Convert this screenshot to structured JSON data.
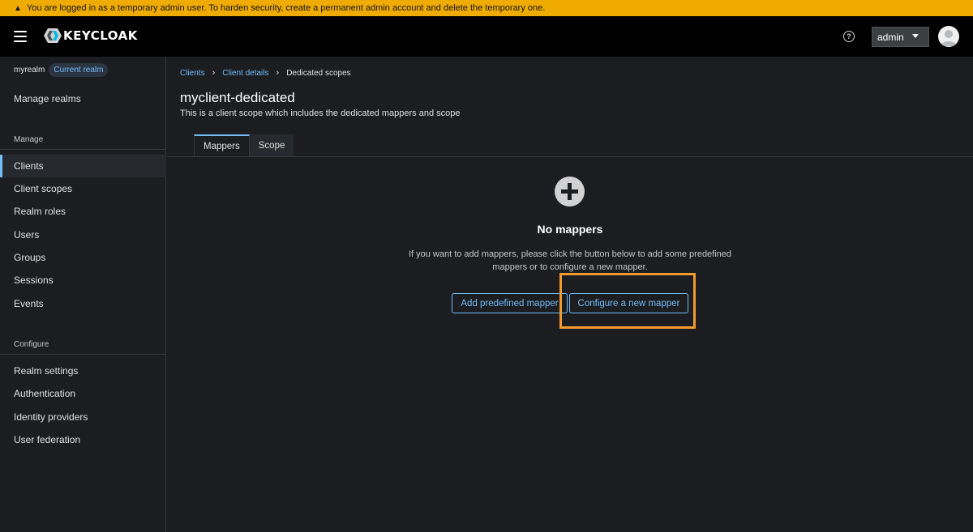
{
  "banner": {
    "text": "You are logged in as a temporary admin user. To harden security, create a permanent admin account and delete the temporary one."
  },
  "header": {
    "logo_text": "KEYCLOAK",
    "user_label": "admin"
  },
  "sidebar": {
    "realm_name": "myrealm",
    "realm_badge": "Current realm",
    "manage_realms": "Manage realms",
    "manage_section": "Manage",
    "manage_items": [
      "Clients",
      "Client scopes",
      "Realm roles",
      "Users",
      "Groups",
      "Sessions",
      "Events"
    ],
    "configure_section": "Configure",
    "configure_items": [
      "Realm settings",
      "Authentication",
      "Identity providers",
      "User federation"
    ],
    "active_item": "Clients"
  },
  "breadcrumb": {
    "items": [
      "Clients",
      "Client details",
      "Dedicated scopes"
    ]
  },
  "page": {
    "title": "myclient-dedicated",
    "description": "This is a client scope which includes the dedicated mappers and scope"
  },
  "tabs": [
    {
      "label": "Mappers",
      "active": true
    },
    {
      "label": "Scope",
      "active": false
    }
  ],
  "empty_state": {
    "title": "No mappers",
    "body": "If you want to add mappers, please click the button below to add some predefined mappers or to configure a new mapper.",
    "add_predefined_label": "Add predefined mapper",
    "configure_new_label": "Configure a new mapper"
  },
  "colors": {
    "accent": "#73bcf7",
    "banner": "#f0ab00",
    "highlight": "#f09a2d"
  }
}
